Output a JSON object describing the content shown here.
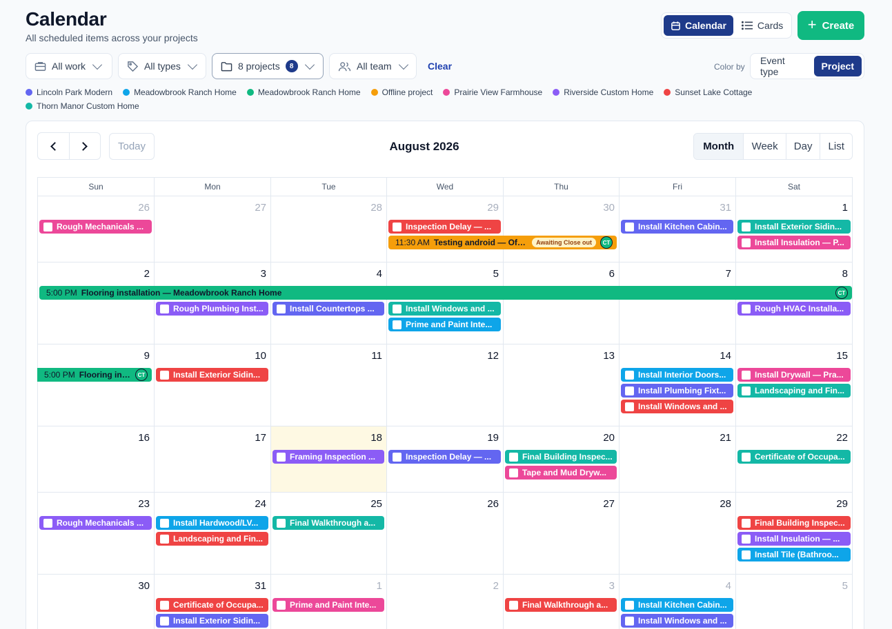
{
  "header": {
    "title": "Calendar",
    "subtitle": "All scheduled items across your projects",
    "view_calendar": "Calendar",
    "view_cards": "Cards",
    "create_label": "Create"
  },
  "filters": {
    "work": "All work",
    "types": "All types",
    "projects": "8 projects",
    "projects_count": "8",
    "team": "All team",
    "clear": "Clear"
  },
  "color_by": {
    "label": "Color by",
    "event_type": "Event type",
    "project": "Project",
    "active": "Project"
  },
  "legend": [
    {
      "name": "Lincoln Park Modern",
      "color": "#6366f1"
    },
    {
      "name": "Meadowbrook Ranch Home",
      "color": "#0ea5e9"
    },
    {
      "name": "Meadowbrook Ranch Home",
      "color": "#10b981"
    },
    {
      "name": "Offline project",
      "color": "#f59e0b"
    },
    {
      "name": "Prairie View Farmhouse",
      "color": "#ec4899"
    },
    {
      "name": "Riverside Custom Home",
      "color": "#8b5cf6"
    },
    {
      "name": "Sunset Lake Cottage",
      "color": "#ef4444"
    },
    {
      "name": "Thorn Manor Custom Home",
      "color": "#14b8a6"
    }
  ],
  "calendar": {
    "month_title": "August 2026",
    "today_label": "Today",
    "ranges": [
      "Month",
      "Week",
      "Day",
      "List"
    ],
    "active_range": "Month",
    "weekdays": [
      "Sun",
      "Mon",
      "Tue",
      "Wed",
      "Thu",
      "Fri",
      "Sat"
    ],
    "weeks": [
      [
        {
          "d": "26",
          "o": true
        },
        {
          "d": "27",
          "o": true
        },
        {
          "d": "28",
          "o": true
        },
        {
          "d": "29",
          "o": true
        },
        {
          "d": "30",
          "o": true
        },
        {
          "d": "31",
          "o": true
        },
        {
          "d": "1"
        }
      ],
      [
        {
          "d": "2"
        },
        {
          "d": "3"
        },
        {
          "d": "4"
        },
        {
          "d": "5"
        },
        {
          "d": "6"
        },
        {
          "d": "7"
        },
        {
          "d": "8"
        }
      ],
      [
        {
          "d": "9"
        },
        {
          "d": "10"
        },
        {
          "d": "11"
        },
        {
          "d": "12"
        },
        {
          "d": "13"
        },
        {
          "d": "14"
        },
        {
          "d": "15"
        }
      ],
      [
        {
          "d": "16"
        },
        {
          "d": "17"
        },
        {
          "d": "18",
          "today": true
        },
        {
          "d": "19"
        },
        {
          "d": "20"
        },
        {
          "d": "21"
        },
        {
          "d": "22"
        }
      ],
      [
        {
          "d": "23"
        },
        {
          "d": "24"
        },
        {
          "d": "25"
        },
        {
          "d": "26"
        },
        {
          "d": "27"
        },
        {
          "d": "28"
        },
        {
          "d": "29"
        }
      ],
      [
        {
          "d": "30"
        },
        {
          "d": "31"
        },
        {
          "d": "1",
          "o": true
        },
        {
          "d": "2",
          "o": true
        },
        {
          "d": "3",
          "o": true
        },
        {
          "d": "4",
          "o": true
        },
        {
          "d": "5",
          "o": true
        }
      ]
    ],
    "events": [
      {
        "w": 0,
        "c": 0,
        "slot": 0,
        "span": 1,
        "title": "Rough Mechanicals ...",
        "color": "#ec4899"
      },
      {
        "w": 0,
        "c": 3,
        "slot": 0,
        "span": 1,
        "title": "Inspection Delay — ...",
        "color": "#ef4444"
      },
      {
        "w": 0,
        "c": 3,
        "slot": 1,
        "span": 2,
        "time": "11:30 AM",
        "title": "Testing android — Offli...",
        "color": "#f59e0b",
        "status": "Awaiting Close out",
        "avatar": "CT",
        "dark": true
      },
      {
        "w": 0,
        "c": 5,
        "slot": 0,
        "span": 1,
        "title": "Install Kitchen Cabin...",
        "color": "#6366f1"
      },
      {
        "w": 0,
        "c": 6,
        "slot": 0,
        "span": 1,
        "title": "Install Exterior Sidin...",
        "color": "#14b8a6"
      },
      {
        "w": 0,
        "c": 6,
        "slot": 1,
        "span": 1,
        "title": "Install Insulation — P...",
        "color": "#ec4899"
      },
      {
        "w": 1,
        "c": 0,
        "slot": 0,
        "span": 7,
        "time": "5:00 PM",
        "title": "Flooring installation — Meadowbrook Ranch Home",
        "color": "#10b981",
        "avatar": "CT",
        "dark": true
      },
      {
        "w": 1,
        "c": 1,
        "slot": 1,
        "span": 1,
        "title": "Rough Plumbing Inst...",
        "color": "#8b5cf6"
      },
      {
        "w": 1,
        "c": 2,
        "slot": 1,
        "span": 1,
        "title": "Install Countertops ...",
        "color": "#6366f1"
      },
      {
        "w": 1,
        "c": 3,
        "slot": 1,
        "span": 1,
        "title": "Install Windows and ...",
        "color": "#14b8a6"
      },
      {
        "w": 1,
        "c": 3,
        "slot": 2,
        "span": 1,
        "title": "Prime and Paint Inte...",
        "color": "#0ea5e9"
      },
      {
        "w": 1,
        "c": 6,
        "slot": 1,
        "span": 1,
        "title": "Rough HVAC Installa...",
        "color": "#8b5cf6"
      },
      {
        "w": 2,
        "c": 0,
        "slot": 0,
        "span": 1,
        "time": "5:00 PM",
        "title": "Flooring ins...",
        "color": "#10b981",
        "avatar": "CT",
        "dark": true,
        "cont": true
      },
      {
        "w": 2,
        "c": 1,
        "slot": 0,
        "span": 1,
        "title": "Install Exterior Sidin...",
        "color": "#ef4444"
      },
      {
        "w": 2,
        "c": 5,
        "slot": 0,
        "span": 1,
        "title": "Install Interior Doors...",
        "color": "#0ea5e9"
      },
      {
        "w": 2,
        "c": 5,
        "slot": 1,
        "span": 1,
        "title": "Install Plumbing Fixt...",
        "color": "#6366f1"
      },
      {
        "w": 2,
        "c": 5,
        "slot": 2,
        "span": 1,
        "title": "Install Windows and ...",
        "color": "#ef4444"
      },
      {
        "w": 2,
        "c": 6,
        "slot": 0,
        "span": 1,
        "title": "Install Drywall — Pra...",
        "color": "#ec4899"
      },
      {
        "w": 2,
        "c": 6,
        "slot": 1,
        "span": 1,
        "title": "Landscaping and Fin...",
        "color": "#14b8a6"
      },
      {
        "w": 3,
        "c": 2,
        "slot": 0,
        "span": 1,
        "title": "Framing Inspection ...",
        "color": "#8b5cf6"
      },
      {
        "w": 3,
        "c": 3,
        "slot": 0,
        "span": 1,
        "title": "Inspection Delay — ...",
        "color": "#6366f1"
      },
      {
        "w": 3,
        "c": 4,
        "slot": 0,
        "span": 1,
        "title": "Final Building Inspec...",
        "color": "#14b8a6"
      },
      {
        "w": 3,
        "c": 4,
        "slot": 1,
        "span": 1,
        "title": "Tape and Mud Dryw...",
        "color": "#ec4899"
      },
      {
        "w": 3,
        "c": 6,
        "slot": 0,
        "span": 1,
        "title": "Certificate of Occupa...",
        "color": "#14b8a6"
      },
      {
        "w": 4,
        "c": 0,
        "slot": 0,
        "span": 1,
        "title": "Rough Mechanicals ...",
        "color": "#8b5cf6"
      },
      {
        "w": 4,
        "c": 1,
        "slot": 0,
        "span": 1,
        "title": "Install Hardwood/LV...",
        "color": "#0ea5e9"
      },
      {
        "w": 4,
        "c": 1,
        "slot": 1,
        "span": 1,
        "title": "Landscaping and Fin...",
        "color": "#ef4444"
      },
      {
        "w": 4,
        "c": 2,
        "slot": 0,
        "span": 1,
        "title": "Final Walkthrough a...",
        "color": "#14b8a6"
      },
      {
        "w": 4,
        "c": 6,
        "slot": 0,
        "span": 1,
        "title": "Final Building Inspec...",
        "color": "#ef4444"
      },
      {
        "w": 4,
        "c": 6,
        "slot": 1,
        "span": 1,
        "title": "Install Insulation — ...",
        "color": "#8b5cf6"
      },
      {
        "w": 4,
        "c": 6,
        "slot": 2,
        "span": 1,
        "title": "Install Tile (Bathroo...",
        "color": "#0ea5e9"
      },
      {
        "w": 5,
        "c": 1,
        "slot": 0,
        "span": 1,
        "title": "Certificate of Occupa...",
        "color": "#ef4444"
      },
      {
        "w": 5,
        "c": 1,
        "slot": 1,
        "span": 1,
        "title": "Install Exterior Sidin...",
        "color": "#6366f1"
      },
      {
        "w": 5,
        "c": 2,
        "slot": 0,
        "span": 1,
        "title": "Prime and Paint Inte...",
        "color": "#ec4899"
      },
      {
        "w": 5,
        "c": 4,
        "slot": 0,
        "span": 1,
        "title": "Final Walkthrough a...",
        "color": "#ef4444"
      },
      {
        "w": 5,
        "c": 5,
        "slot": 0,
        "span": 1,
        "title": "Install Kitchen Cabin...",
        "color": "#0ea5e9"
      },
      {
        "w": 5,
        "c": 5,
        "slot": 1,
        "span": 1,
        "title": "Install Windows and ...",
        "color": "#6366f1"
      }
    ]
  }
}
